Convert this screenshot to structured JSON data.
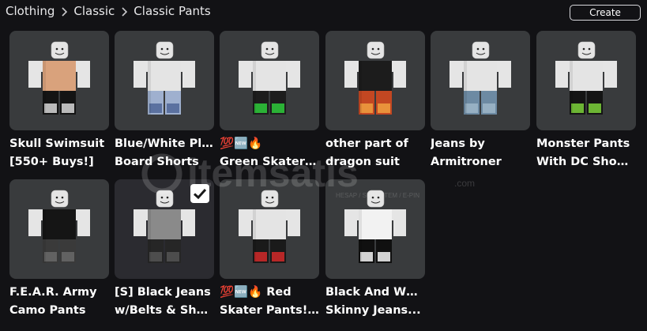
{
  "breadcrumb": {
    "items": [
      "Clothing",
      "Classic",
      "Classic Pants"
    ]
  },
  "create_label": "Create",
  "watermark": {
    "text": "itemsatis",
    "subtext": "HESAP / SKIN / İTEM / E-PIN",
    "suffix": ".com"
  },
  "items": [
    {
      "line1": "Skull Swimsuit",
      "line2": "[550+ Buys!]",
      "shirt": "#d9a27c",
      "pants": "#141414",
      "pantsAccent": "#d7d7d7",
      "selected": false
    },
    {
      "line1": "Blue/White Plaid",
      "line2": "Board Shorts",
      "shirt": "#e4e4e4",
      "pants": "#9fb0cf",
      "pantsAccent": "#4f6698",
      "selected": false
    },
    {
      "line1": "💯🆕🔥",
      "line2": "Green Skater Pants!...",
      "shirt": "#e4e4e4",
      "pants": "#1d1d1d",
      "pantsAccent": "#2ecc3b",
      "selected": false
    },
    {
      "line1": "other part of",
      "line2": "dragon suit",
      "shirt": "#1c1c1c",
      "pants": "#c34722",
      "pantsAccent": "#f0a040",
      "selected": false
    },
    {
      "line1": "Jeans by",
      "line2": "Armitroner",
      "shirt": "#e4e4e4",
      "pants": "#6d8aa3",
      "pantsAccent": "#9fb6c9",
      "selected": false
    },
    {
      "line1": "Monster Pants",
      "line2": "With DC Shoes....",
      "shirt": "#e4e4e4",
      "pants": "#141414",
      "pantsAccent": "#7bd13a",
      "selected": false
    },
    {
      "line1": "F.E.A.R. Army",
      "line2": "Camo Pants",
      "shirt": "#151515",
      "pants": "#3a3a3a",
      "pantsAccent": "#6a6a6a",
      "selected": false
    },
    {
      "line1": "[S] Black Jeans",
      "line2": "w/Belts & Shoe...",
      "shirt": "#8a8a8a",
      "pants": "#262626",
      "pantsAccent": "#555555",
      "selected": true
    },
    {
      "line1": "💯🆕🔥 Red",
      "line2": "Skater Pants!...",
      "shirt": "#e4e4e4",
      "pants": "#1a1a1a",
      "pantsAccent": "#d42a2a",
      "selected": false
    },
    {
      "line1": "Black And White",
      "line2": "Skinny Jeans...",
      "shirt": "#f2f2f2",
      "pants": "#101010",
      "pantsAccent": "#f4f4f4",
      "selected": false
    }
  ],
  "colors": {
    "background": "#121215",
    "card": "#393b3d",
    "card_selected": "#2b2b30",
    "text": "#ffffff",
    "skin": "#e5e5e5"
  }
}
